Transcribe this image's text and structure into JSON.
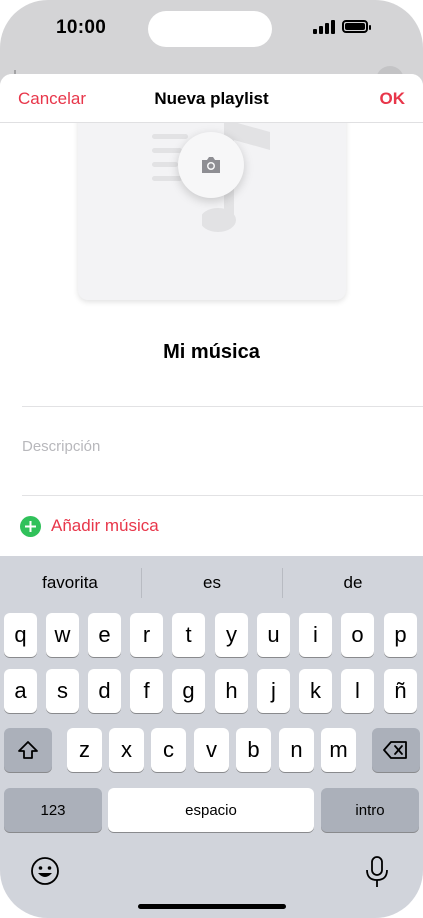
{
  "status_bar": {
    "time": "10:00"
  },
  "nav": {
    "cancel": "Cancelar",
    "title": "Nueva playlist",
    "ok": "OK"
  },
  "playlist": {
    "name": "Mi música",
    "description_placeholder": "Descripción",
    "add_music": "Añadir música"
  },
  "keyboard": {
    "suggestions": [
      "favorita",
      "es",
      "de"
    ],
    "row1": [
      "q",
      "w",
      "e",
      "r",
      "t",
      "y",
      "u",
      "i",
      "o",
      "p"
    ],
    "row2": [
      "a",
      "s",
      "d",
      "f",
      "g",
      "h",
      "j",
      "k",
      "l",
      "ñ"
    ],
    "row3": [
      "z",
      "x",
      "c",
      "v",
      "b",
      "n",
      "m"
    ],
    "numbers_key": "123",
    "space_key": "espacio",
    "return_key": "intro"
  },
  "colors": {
    "accent": "#e8364a",
    "add_green": "#30c15a"
  }
}
